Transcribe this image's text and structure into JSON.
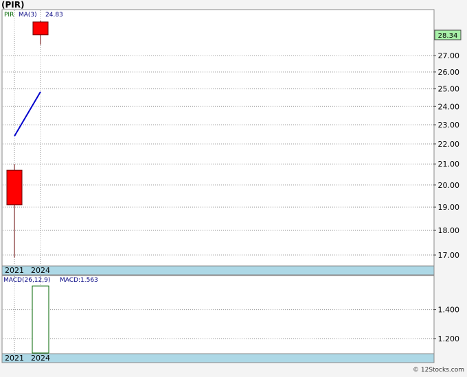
{
  "title": "(PIR)",
  "watermark": "© 12Stocks.com",
  "colors": {
    "up_candle": "#ff0000",
    "ma_line": "#0000cc",
    "macd_bar": "#006600",
    "axis_band": "#add8e6",
    "last_price_badge": "#a8f0a8",
    "ticker_label": "#006600",
    "legend_text": "#000080"
  },
  "legend": {
    "ticker": "PIR",
    "ma_label": "MA(3)",
    "ma_value": "24.83",
    "macd_label": "MACD(26,12,9)",
    "macd_value": "MACD:1.563"
  },
  "chart_data": [
    {
      "type": "candlestick",
      "ticker": "PIR",
      "x": [
        "2021",
        "2024"
      ],
      "candles": [
        {
          "period": "2021",
          "open": 20.7,
          "high": 21.0,
          "low": 16.9,
          "close": 19.1
        },
        {
          "period": "2024",
          "open": 29.2,
          "high": 29.3,
          "low": 27.7,
          "close": 28.34
        }
      ],
      "ma": {
        "label": "MA(3)",
        "points": [
          {
            "x": "2021",
            "y": 22.4
          },
          {
            "x": "2024",
            "y": 24.83
          }
        ]
      },
      "last_price": "28.34",
      "y_ticks": [
        "17.00",
        "18.00",
        "19.00",
        "20.00",
        "21.00",
        "22.00",
        "23.00",
        "24.00",
        "25.00",
        "26.00",
        "27.00"
      ],
      "ylim": [
        16.6,
        30.0
      ],
      "y_scale": "log",
      "x_tick_labels": [
        "2021",
        "2024"
      ],
      "grid": true
    },
    {
      "type": "bar",
      "label": "MACD(26,12,9)",
      "categories": [
        "2024"
      ],
      "values": [
        1.563
      ],
      "y_ticks": [
        "1.200",
        "1.400"
      ],
      "ylim": [
        1.1,
        1.63
      ],
      "x_tick_labels": [
        "2021",
        "2024"
      ],
      "grid": true
    }
  ]
}
